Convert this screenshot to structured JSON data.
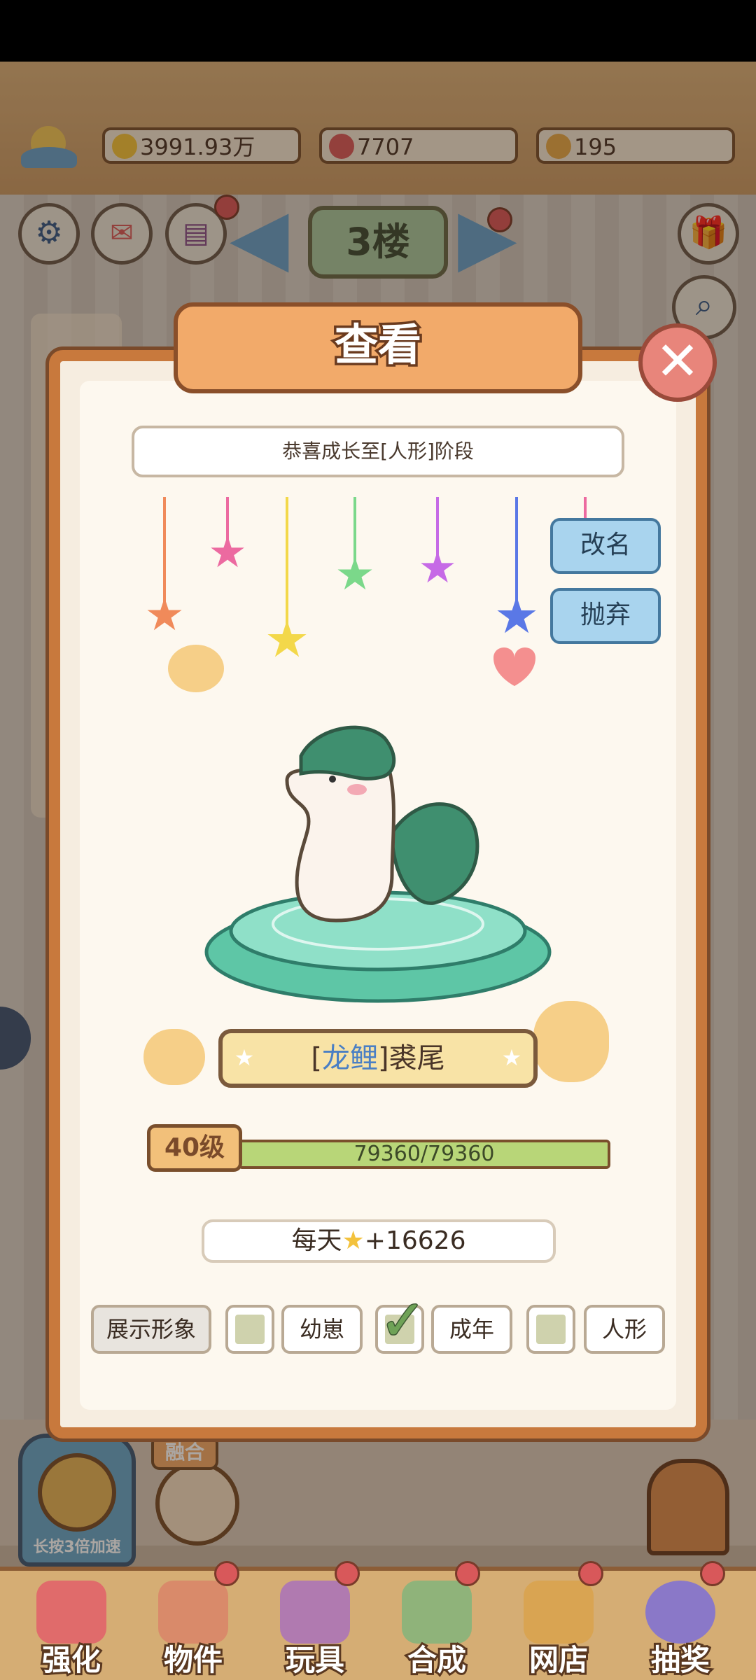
{
  "resources": [
    {
      "icon": "star-coin-icon",
      "value": "3991.93万",
      "color": "#f3c23d"
    },
    {
      "icon": "heart-icon",
      "value": "7707",
      "color": "#d95b5b"
    },
    {
      "icon": "coin-icon",
      "value": "195",
      "color": "#e5a94a"
    }
  ],
  "floor_label": "3楼",
  "dialog": {
    "title": "查看",
    "message": "恭喜成长至[人形]阶段",
    "rename_label": "改名",
    "abandon_label": "抛弃",
    "name_prefix": "[",
    "name_species": "龙鲤",
    "name_suffix": "]裘尾",
    "level_label": "40级",
    "xp_text": "79360/79360",
    "xp_progress": 1.0,
    "daily_prefix": "每天",
    "daily_suffix": "+16626",
    "display_label": "展示形象",
    "forms": [
      {
        "label": "幼崽",
        "checked": false
      },
      {
        "label": "成年",
        "checked": true
      },
      {
        "label": "人形",
        "checked": false
      }
    ]
  },
  "speed_label": "长按3倍加速",
  "merge_label": "融合",
  "nav": [
    {
      "label": "强化",
      "color": "#e06b6b"
    },
    {
      "label": "物件",
      "color": "#d98a6a"
    },
    {
      "label": "玩具",
      "color": "#b07ab0"
    },
    {
      "label": "合成",
      "color": "#8fb37a"
    },
    {
      "label": "网店",
      "color": "#d9a452"
    },
    {
      "label": "抽奖",
      "color": "#8a78c8"
    }
  ],
  "colors": {
    "accent": "#c8793d",
    "panel": "#fdf8ef",
    "name_species": "#4a7fc4"
  }
}
